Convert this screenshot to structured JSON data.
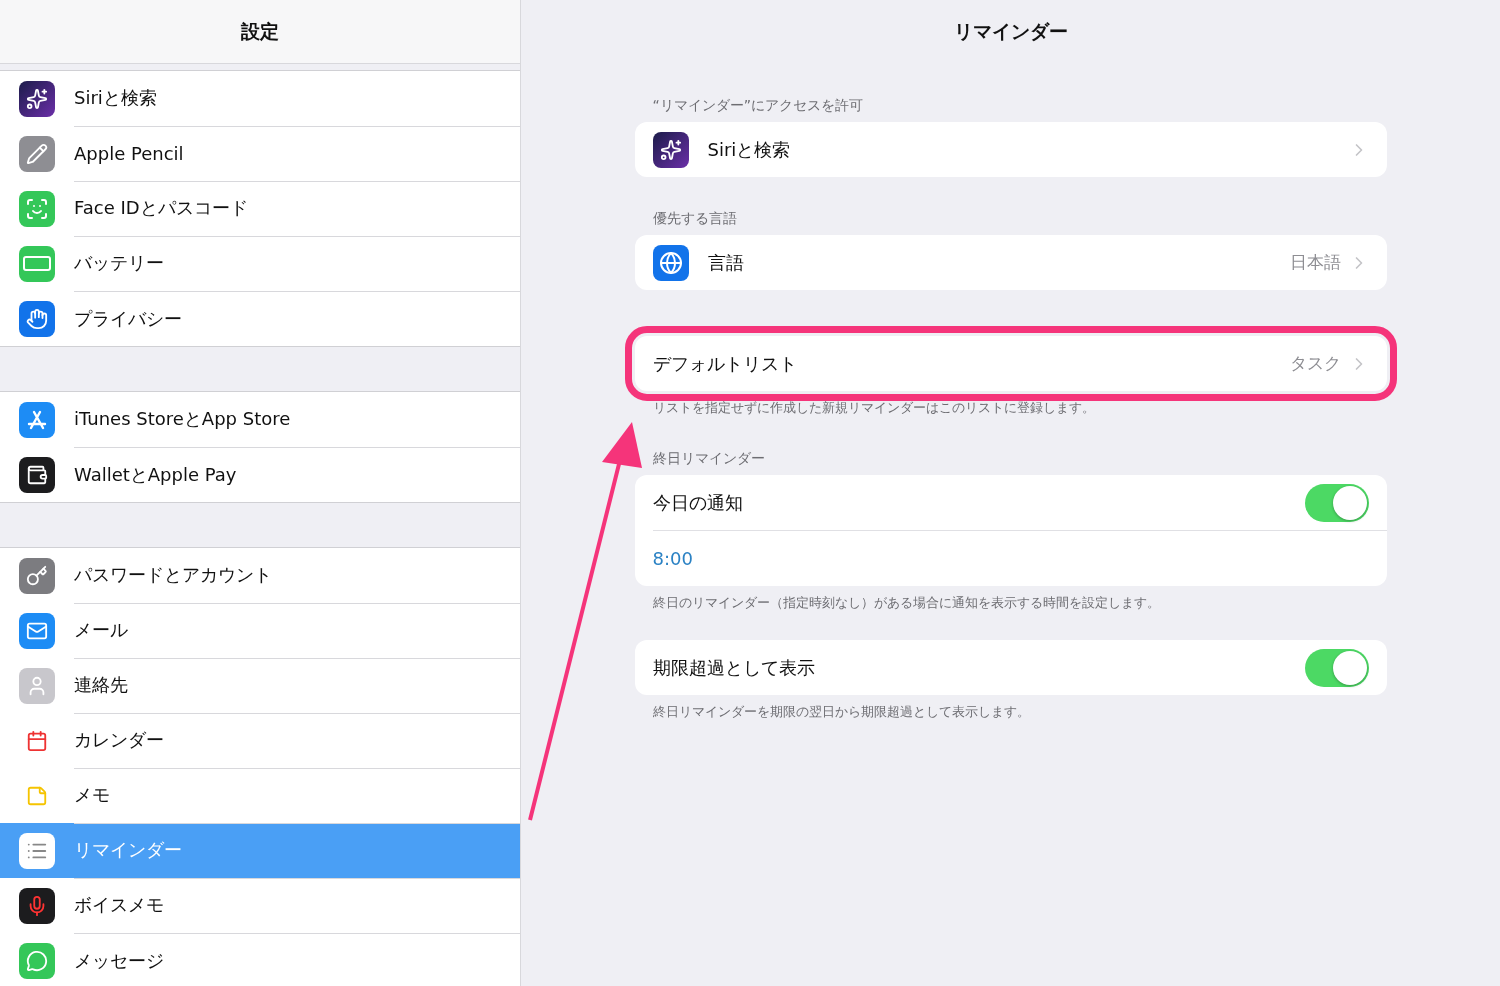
{
  "sidebar": {
    "title": "設定",
    "groups": [
      {
        "items": [
          {
            "label": "Siriと検索",
            "selected": false
          },
          {
            "label": "Apple Pencil",
            "selected": false
          },
          {
            "label": "Face IDとパスコード",
            "selected": false
          },
          {
            "label": "バッテリー",
            "selected": false
          },
          {
            "label": "プライバシー",
            "selected": false
          }
        ]
      },
      {
        "items": [
          {
            "label": "iTunes StoreとApp Store",
            "selected": false
          },
          {
            "label": "WalletとApple Pay",
            "selected": false
          }
        ]
      },
      {
        "items": [
          {
            "label": "パスワードとアカウント",
            "selected": false
          },
          {
            "label": "メール",
            "selected": false
          },
          {
            "label": "連絡先",
            "selected": false
          },
          {
            "label": "カレンダー",
            "selected": false
          },
          {
            "label": "メモ",
            "selected": false
          },
          {
            "label": "リマインダー",
            "selected": true
          },
          {
            "label": "ボイスメモ",
            "selected": false
          },
          {
            "label": "メッセージ",
            "selected": false
          }
        ]
      }
    ]
  },
  "detail": {
    "title": "リマインダー",
    "sections": [
      {
        "header": "“リマインダー”にアクセスを許可",
        "rows": [
          {
            "kind": "app",
            "label": "Siriと検索"
          }
        ]
      },
      {
        "header": "優先する言語",
        "rows": [
          {
            "kind": "app",
            "label": "言語",
            "value": "日本語"
          }
        ]
      },
      {
        "highlighted": true,
        "footer": "リストを指定せずに作成した新規リマインダーはこのリストに登録します。",
        "rows": [
          {
            "kind": "link",
            "label": "デフォルトリスト",
            "value": "タスク"
          }
        ]
      },
      {
        "header": "終日リマインダー",
        "footer": "終日のリマインダー（指定時刻なし）がある場合に通知を表示する時間を設定します。",
        "rows": [
          {
            "kind": "toggle",
            "label": "今日の通知",
            "on": true
          },
          {
            "kind": "time",
            "label": "8:00"
          }
        ]
      },
      {
        "footer": "終日リマインダーを期限の翌日から期限超過として表示します。",
        "rows": [
          {
            "kind": "toggle",
            "label": "期限超過として表示",
            "on": true
          }
        ]
      }
    ]
  }
}
